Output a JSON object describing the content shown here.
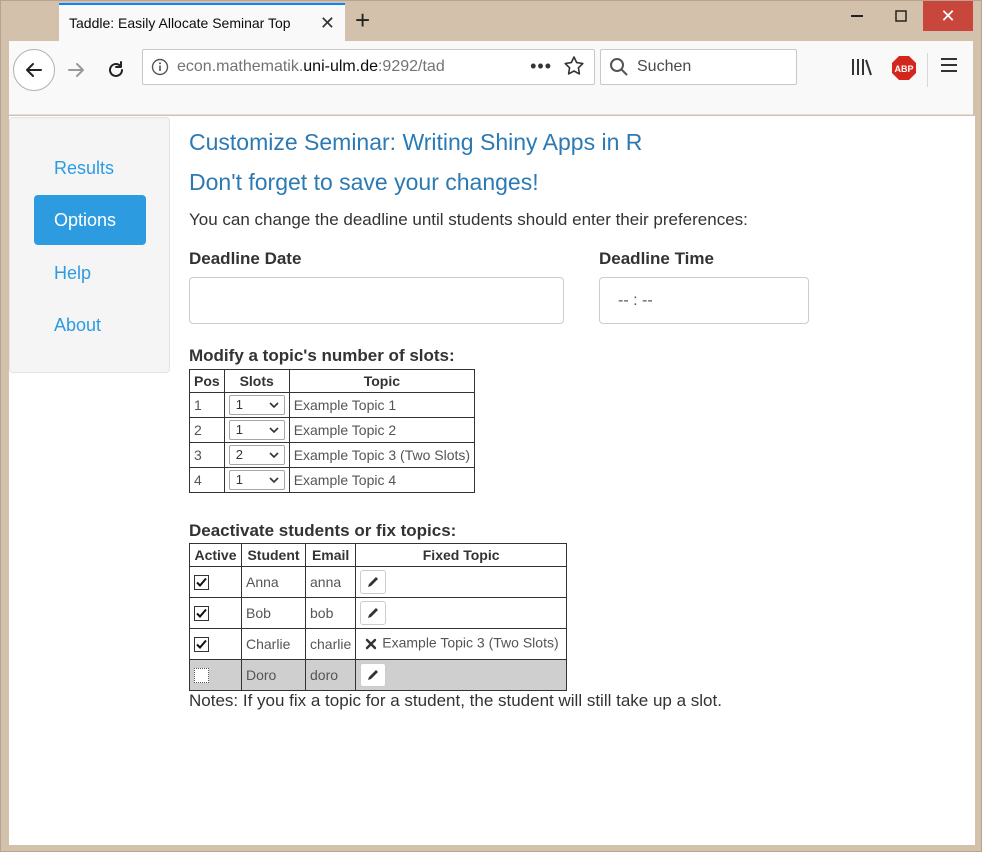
{
  "browser": {
    "tab_title": "Taddle: Easily Allocate Seminar Top",
    "url_prefix": "econ.mathematik.",
    "url_domain": "uni-ulm.de",
    "url_suffix": ":9292/tad",
    "search_placeholder": "Suchen",
    "abp_label": "ABP"
  },
  "sidebar": {
    "items": [
      {
        "label": "Results",
        "active": false
      },
      {
        "label": "Options",
        "active": true
      },
      {
        "label": "Help",
        "active": false
      },
      {
        "label": "About",
        "active": false
      }
    ]
  },
  "main": {
    "title": "Customize Seminar: Writing Shiny Apps in R",
    "warning": "Don't forget to save your changes!",
    "intro": "You can change the deadline until students should enter their preferences:",
    "deadline_date_label": "Deadline Date",
    "deadline_date_value": "",
    "deadline_time_label": "Deadline Time",
    "deadline_time_value": "-- : --",
    "slots_heading": "Modify a topic's number of slots:",
    "slots_table": {
      "headers": [
        "Pos",
        "Slots",
        "Topic"
      ],
      "rows": [
        {
          "pos": "1",
          "slots": "1",
          "topic": "Example Topic 1"
        },
        {
          "pos": "2",
          "slots": "1",
          "topic": "Example Topic 2"
        },
        {
          "pos": "3",
          "slots": "2",
          "topic": "Example Topic 3 (Two Slots)"
        },
        {
          "pos": "4",
          "slots": "1",
          "topic": "Example Topic 4"
        }
      ]
    },
    "students_heading": "Deactivate students or fix topics:",
    "students_table": {
      "headers": [
        "Active",
        "Student",
        "Email",
        "Fixed Topic"
      ],
      "rows": [
        {
          "active": true,
          "student": "Anna",
          "email": "anna",
          "fixed_topic": "",
          "action_icon": "pencil-icon"
        },
        {
          "active": true,
          "student": "Bob",
          "email": "bob",
          "fixed_topic": "",
          "action_icon": "pencil-icon"
        },
        {
          "active": true,
          "student": "Charlie",
          "email": "charlie",
          "fixed_topic": "Example Topic 3 (Two Slots)",
          "action_icon": "remove-icon"
        },
        {
          "active": false,
          "student": "Doro",
          "email": "doro",
          "fixed_topic": "",
          "action_icon": "pencil-icon"
        }
      ]
    },
    "notes": "Notes: If you fix a topic for a student, the student will still take up a slot."
  },
  "colors": {
    "accent": "#2d9be0",
    "heading": "#2c7ab3",
    "inactive_row": "#cfcfcf",
    "close_button": "#c9463d"
  }
}
